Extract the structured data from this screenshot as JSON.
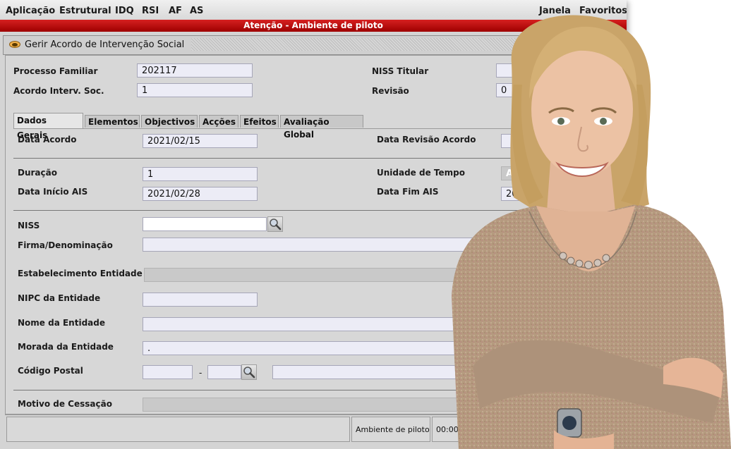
{
  "menubar": {
    "items": [
      "Aplicação",
      "Estrutural",
      "IDQ",
      "RSI",
      "AF",
      "AS"
    ],
    "right_items": [
      "Janela",
      "Favoritos"
    ]
  },
  "warning_bar": {
    "text": "Atenção -  Ambiente de piloto"
  },
  "window": {
    "title": "Gerir Acordo de Intervenção Social"
  },
  "header_fields": {
    "processo_familiar": {
      "label": "Processo Familiar",
      "value": "202117"
    },
    "acordo_interv": {
      "label": "Acordo Interv. Soc.",
      "value": "1"
    },
    "niss_titular": {
      "label": "NISS Titular",
      "value": ""
    },
    "revisao": {
      "label": "Revisão",
      "value": "0"
    }
  },
  "tabs": [
    {
      "label": "Dados Gerais",
      "active": true
    },
    {
      "label": "Elementos",
      "active": false
    },
    {
      "label": "Objectivos",
      "active": false
    },
    {
      "label": "Acções",
      "active": false
    },
    {
      "label": "Efeitos",
      "active": false
    },
    {
      "label": "Avaliação Global",
      "active": false
    }
  ],
  "form": {
    "data_acordo": {
      "label": "Data Acordo",
      "value": "2021/02/15"
    },
    "data_revisao_acordo": {
      "label": "Data Revisão Acordo",
      "value": ""
    },
    "duracao": {
      "label": "Duração",
      "value": "1"
    },
    "unidade_tempo": {
      "label": "Unidade de Tempo",
      "value": "A"
    },
    "data_inicio_ais": {
      "label": "Data Início AIS",
      "value": "2021/02/28"
    },
    "data_fim_ais": {
      "label": "Data Fim AIS",
      "value": "202"
    },
    "niss": {
      "label": "NISS",
      "value": ""
    },
    "firma": {
      "label": "Firma/Denominação",
      "value": ""
    },
    "estabelecimento": {
      "label": "Estabelecimento Entidade",
      "value": ""
    },
    "nipc": {
      "label": "NIPC da Entidade",
      "value": ""
    },
    "nome_entidade": {
      "label": "Nome da Entidade",
      "value": ""
    },
    "morada": {
      "label": "Morada da Entidade",
      "value": "."
    },
    "codigo_postal": {
      "label": "Código Postal",
      "value1": "",
      "separator": "-",
      "value2": "",
      "locality": ""
    },
    "motivo_cessacao": {
      "label": "Motivo de Cessação",
      "value": ""
    }
  },
  "statusbar": {
    "message": "",
    "environment": "Ambiente de piloto",
    "timer": "00:00:413"
  },
  "icons": {
    "title_icon": "eye-icon",
    "search": "magnifier-icon"
  },
  "colors": {
    "warning_bar": "#b00000",
    "field_bg": "#ececf6",
    "window_bg": "#d4d4d4"
  }
}
